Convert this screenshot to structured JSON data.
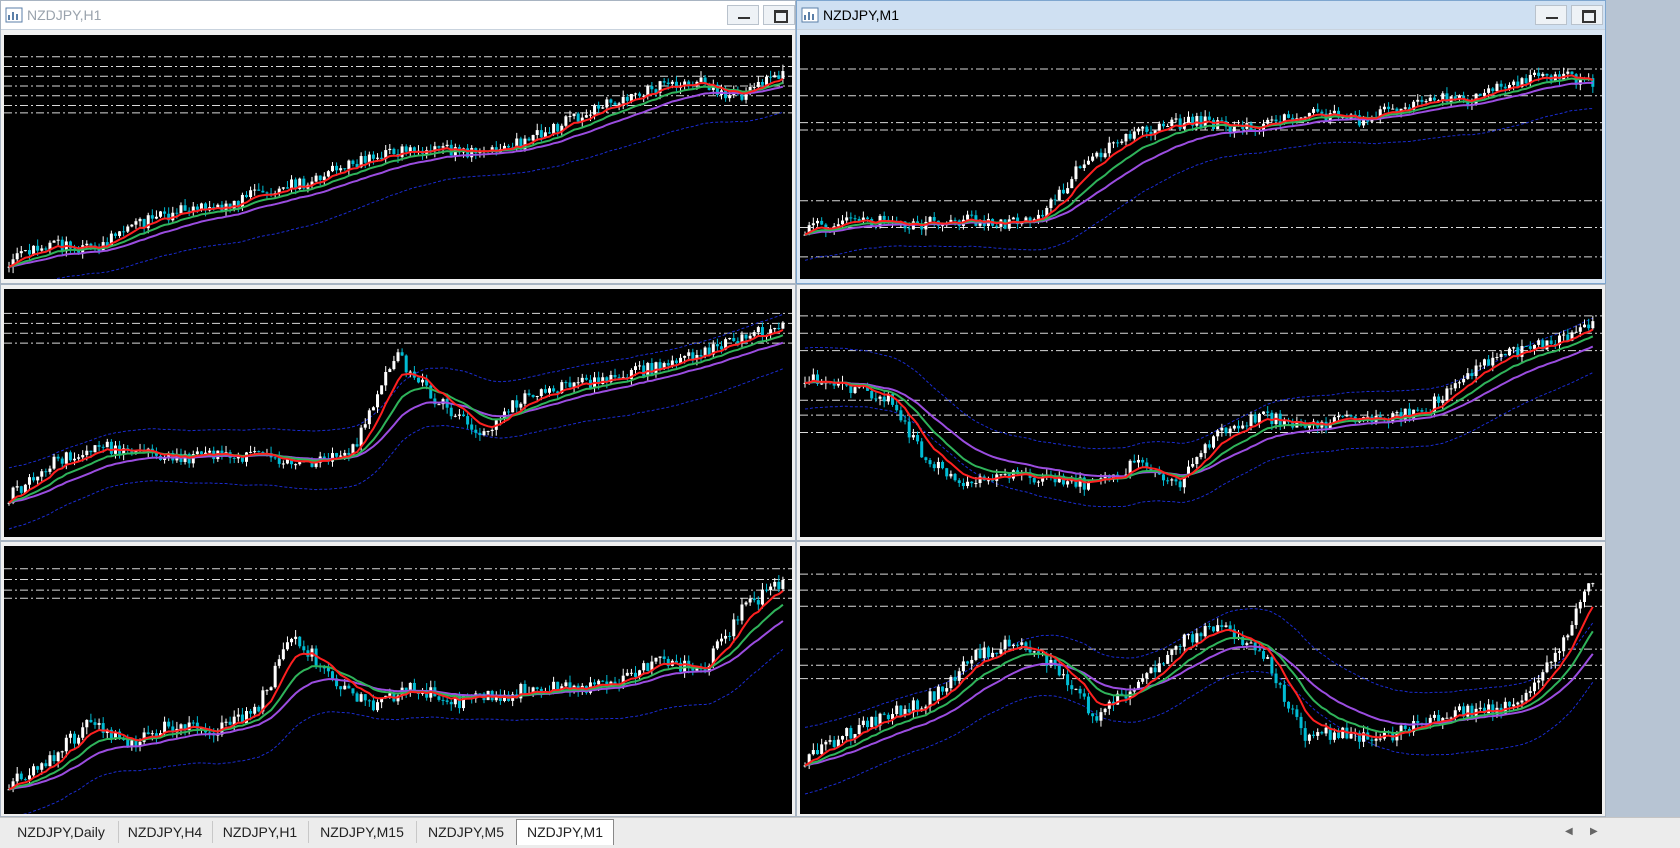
{
  "windows": [
    {
      "title": "NZDJPY,H1",
      "active": false
    },
    {
      "title": "NZDJPY,M1",
      "active": true
    },
    {
      "title": "",
      "active": false
    },
    {
      "title": "",
      "active": false
    },
    {
      "title": "",
      "active": false
    },
    {
      "title": "",
      "active": false
    }
  ],
  "tabs": [
    {
      "label": "NZDJPY,Daily",
      "active": false
    },
    {
      "label": "NZDJPY,H4",
      "active": false
    },
    {
      "label": "NZDJPY,H1",
      "active": false
    },
    {
      "label": "NZDJPY,M15",
      "active": false
    },
    {
      "label": "NZDJPY,M5",
      "active": false
    },
    {
      "label": "NZDJPY,M1",
      "active": true
    }
  ],
  "icons": {
    "window_icon": "chart-window-icon",
    "minimize": "minimize-icon",
    "maximize": "maximize-icon",
    "scroll_left": "arrow-left-icon",
    "scroll_right": "arrow-right-icon"
  },
  "colors": {
    "chart_background": "#000000",
    "bull_candle": "#ffffff",
    "bear_candle": "#00bcd4",
    "ma_fast": "#ff2020",
    "ma_mid": "#2fb35a",
    "ma_slow": "#9b4de0",
    "band": "#1a2bd0",
    "level_line": "#ffffff"
  },
  "chart_data": [
    {
      "type": "candlestick",
      "panel": 1,
      "trend": [
        0.05,
        0.12,
        0.1,
        0.22,
        0.28,
        0.3,
        0.38,
        0.42,
        0.5,
        0.55,
        0.57,
        0.55,
        0.6,
        0.7,
        0.78,
        0.86,
        0.9,
        0.8,
        0.94
      ],
      "levels": [
        0.04,
        0.08,
        0.12,
        0.16,
        0.2,
        0.24,
        0.27
      ],
      "indicators": [
        "ma_fast",
        "ma_mid",
        "ma_slow",
        "band_lower"
      ]
    },
    {
      "type": "candlestick",
      "panel": 2,
      "trend": [
        0.2,
        0.22,
        0.23,
        0.22,
        0.24,
        0.22,
        0.25,
        0.5,
        0.6,
        0.68,
        0.7,
        0.66,
        0.7,
        0.74,
        0.7,
        0.76,
        0.82,
        0.8,
        0.88,
        0.92,
        0.88
      ],
      "levels": [
        0.09,
        0.2,
        0.31,
        0.34,
        0.63,
        0.74,
        0.86
      ],
      "indicators": [
        "ma_fast",
        "ma_mid",
        "ma_slow",
        "band_lower"
      ]
    },
    {
      "type": "candlestick",
      "panel": 3,
      "trend": [
        0.15,
        0.3,
        0.38,
        0.36,
        0.32,
        0.34,
        0.33,
        0.3,
        0.36,
        0.8,
        0.58,
        0.44,
        0.62,
        0.65,
        0.7,
        0.74,
        0.8,
        0.88,
        0.92
      ],
      "levels": [
        0.05,
        0.09,
        0.13,
        0.17
      ],
      "indicators": [
        "ma_fast",
        "ma_mid",
        "ma_slow",
        "band_upper",
        "band_lower"
      ]
    },
    {
      "type": "candlestick",
      "panel": 4,
      "trend": [
        0.7,
        0.66,
        0.6,
        0.3,
        0.2,
        0.26,
        0.22,
        0.2,
        0.3,
        0.2,
        0.45,
        0.52,
        0.48,
        0.5,
        0.5,
        0.55,
        0.72,
        0.8,
        0.86,
        0.94
      ],
      "levels": [
        0.06,
        0.13,
        0.2,
        0.4,
        0.46,
        0.53
      ],
      "indicators": [
        "ma_fast",
        "ma_mid",
        "ma_slow",
        "band_upper",
        "band_lower"
      ]
    },
    {
      "type": "candlestick",
      "panel": 5,
      "trend": [
        0.1,
        0.2,
        0.35,
        0.26,
        0.34,
        0.32,
        0.38,
        0.72,
        0.52,
        0.42,
        0.5,
        0.44,
        0.46,
        0.5,
        0.5,
        0.52,
        0.62,
        0.56,
        0.82,
        0.95
      ],
      "levels": [
        0.04,
        0.08,
        0.12,
        0.15
      ],
      "indicators": [
        "ma_fast",
        "ma_mid",
        "ma_slow",
        "band_lower"
      ]
    },
    {
      "type": "candlestick",
      "panel": 6,
      "trend": [
        0.2,
        0.3,
        0.38,
        0.45,
        0.62,
        0.68,
        0.6,
        0.38,
        0.5,
        0.68,
        0.76,
        0.66,
        0.3,
        0.3,
        0.28,
        0.36,
        0.4,
        0.42,
        0.6,
        0.95
      ],
      "levels": [
        0.06,
        0.12,
        0.18,
        0.34,
        0.4,
        0.45
      ],
      "indicators": [
        "ma_fast",
        "ma_mid",
        "ma_slow",
        "band_upper",
        "band_lower"
      ]
    }
  ]
}
